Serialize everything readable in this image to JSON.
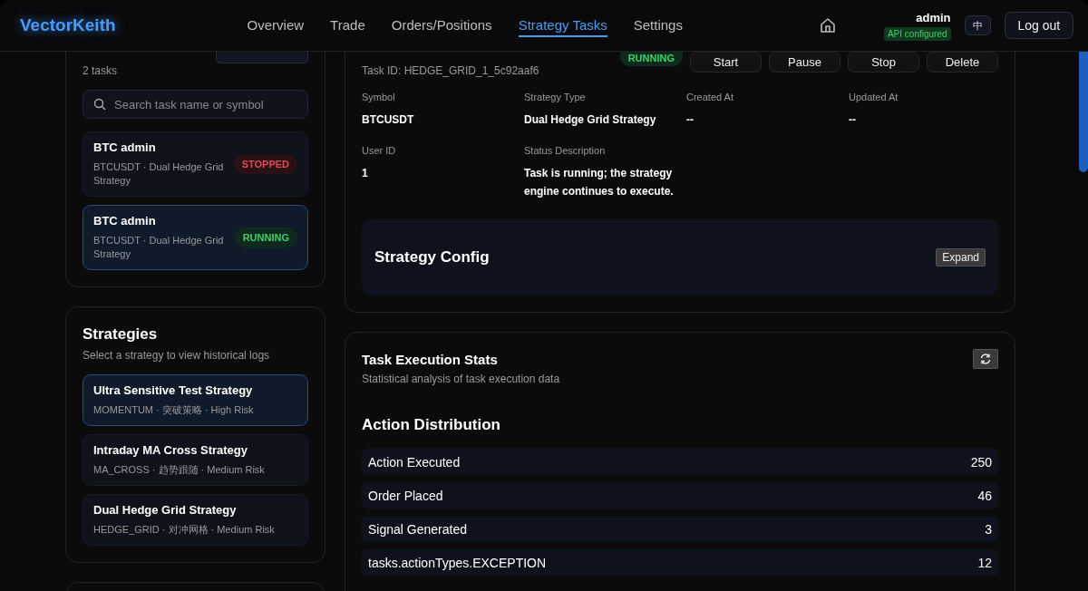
{
  "header": {
    "logo": "VectorKeith",
    "nav": [
      {
        "label": "Overview",
        "selected": false
      },
      {
        "label": "Trade",
        "selected": false
      },
      {
        "label": "Orders/Positions",
        "selected": false
      },
      {
        "label": "Strategy Tasks",
        "selected": true
      },
      {
        "label": "Settings",
        "selected": false
      }
    ],
    "user": "admin",
    "api_status": "API configured",
    "language": "中",
    "logout": "Log out"
  },
  "my_tasks": {
    "count": "2 tasks",
    "search": {
      "placeholder": "Search task name or symbol"
    },
    "items": [
      {
        "name": "BTC admin",
        "detail": "BTCUSDT · Dual Hedge Grid Strategy",
        "status": "STOPPED",
        "kind": "stopped",
        "selected": false
      },
      {
        "name": "BTC admin",
        "detail": "BTCUSDT · Dual Hedge Grid Strategy",
        "status": "RUNNING",
        "kind": "running",
        "selected": true
      }
    ]
  },
  "strategies": {
    "title": "Strategies",
    "subtitle": "Select a strategy to view historical logs",
    "items": [
      {
        "name": "Ultra Sensitive Test Strategy",
        "detail": "MOMENTUM · 突破策略 · High Risk",
        "selected": true
      },
      {
        "name": "Intraday MA Cross Strategy",
        "detail": "MA_CROSS · 趋势跟随 · Medium Risk",
        "selected": false
      },
      {
        "name": "Dual Hedge Grid Strategy",
        "detail": "HEDGE_GRID · 对冲网格 · Medium Risk",
        "selected": false
      }
    ]
  },
  "task_detail": {
    "task_id": "Task ID: HEDGE_GRID_1_5c92aaf6",
    "status": {
      "label": "RUNNING",
      "kind": "running"
    },
    "actions": [
      "Start",
      "Pause",
      "Stop",
      "Delete"
    ],
    "fields": [
      {
        "label": "Symbol",
        "value": "BTCUSDT"
      },
      {
        "label": "Strategy Type",
        "value": "Dual Hedge Grid Strategy"
      },
      {
        "label": "Created At",
        "value": "--"
      },
      {
        "label": "Updated At",
        "value": "--"
      },
      {
        "label": "User ID",
        "value": "1"
      },
      {
        "label": "Status Description",
        "value": "Task is running; the strategy engine continues to execute."
      }
    ],
    "config": {
      "title": "Strategy Config",
      "button": "Expand"
    }
  },
  "stats": {
    "title": "Task Execution Stats",
    "subtitle": "Statistical analysis of task execution data",
    "section": "Action Distribution",
    "rows": [
      {
        "label": "Action Executed",
        "value": "250"
      },
      {
        "label": "Order Placed",
        "value": "46"
      },
      {
        "label": "Signal Generated",
        "value": "3"
      },
      {
        "label": "tasks.actionTypes.EXCEPTION",
        "value": "12"
      }
    ]
  }
}
